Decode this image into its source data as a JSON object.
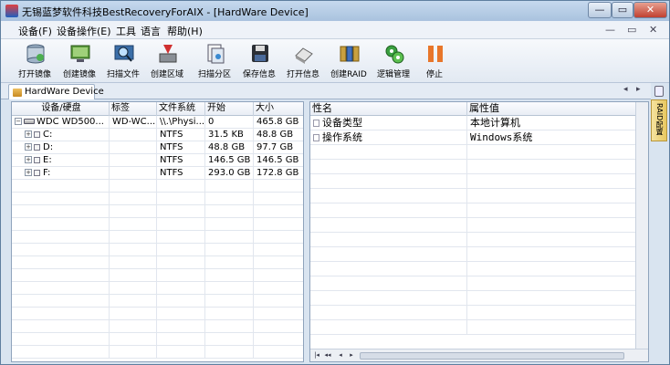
{
  "window": {
    "title": "无锡蓝梦软件科技BestRecoveryForAIX - [HardWare Device]",
    "controls": {
      "minimize": "—",
      "restore": "▭",
      "close": "✕"
    },
    "mdi_controls": {
      "minimize": "—",
      "restore": "▭",
      "close": "✕"
    }
  },
  "menu": [
    {
      "label": "设备(F)"
    },
    {
      "label": "设备操作(E)"
    },
    {
      "label": "工具"
    },
    {
      "label": "语言"
    },
    {
      "label": "帮助(H)"
    }
  ],
  "toolbar": [
    {
      "label": "打开镜像",
      "icon": "open-image-icon"
    },
    {
      "label": "创建镜像",
      "icon": "create-image-icon"
    },
    {
      "label": "扫描文件",
      "icon": "scan-file-icon"
    },
    {
      "label": "创建区域",
      "icon": "create-region-icon"
    },
    {
      "label": "扫描分区",
      "icon": "scan-partition-icon"
    },
    {
      "label": "保存信息",
      "icon": "save-info-icon"
    },
    {
      "label": "打开信息",
      "icon": "open-info-icon"
    },
    {
      "label": "创建RAID",
      "icon": "create-raid-icon"
    },
    {
      "label": "逻辑管理",
      "icon": "logic-manage-icon"
    },
    {
      "label": "停止",
      "icon": "stop-icon"
    }
  ],
  "doc_tab": {
    "label": "HardWare Device"
  },
  "tab_nav": {
    "prev": "◂",
    "next": "▸"
  },
  "side_tab": {
    "label": "RAID配置"
  },
  "device_grid": {
    "columns": [
      "设备/硬盘",
      "标签",
      "文件系统",
      "开始",
      "大小"
    ],
    "rows": [
      {
        "device": "WDC WD500...",
        "label": "WD-WC...",
        "fs": "\\\\.\\Physi...",
        "start": "0",
        "size": "465.8 GB",
        "level": 0
      },
      {
        "device": "C:",
        "label": "",
        "fs": "NTFS",
        "start": "31.5 KB",
        "size": "48.8 GB",
        "level": 1
      },
      {
        "device": "D:",
        "label": "",
        "fs": "NTFS",
        "start": "48.8 GB",
        "size": "97.7 GB",
        "level": 1
      },
      {
        "device": "E:",
        "label": "",
        "fs": "NTFS",
        "start": "146.5 GB",
        "size": "146.5 GB",
        "level": 1
      },
      {
        "device": "F:",
        "label": "",
        "fs": "NTFS",
        "start": "293.0 GB",
        "size": "172.8 GB",
        "level": 1
      }
    ]
  },
  "prop_grid": {
    "columns": [
      "性名",
      "属性值"
    ],
    "rows": [
      {
        "name": "设备类型",
        "value": "本地计算机"
      },
      {
        "name": "操作系统",
        "value": "Windows系统"
      }
    ]
  },
  "colors": {
    "accent": "#a9c2de",
    "stop": "#e8762a",
    "raid": "#c8a040"
  }
}
